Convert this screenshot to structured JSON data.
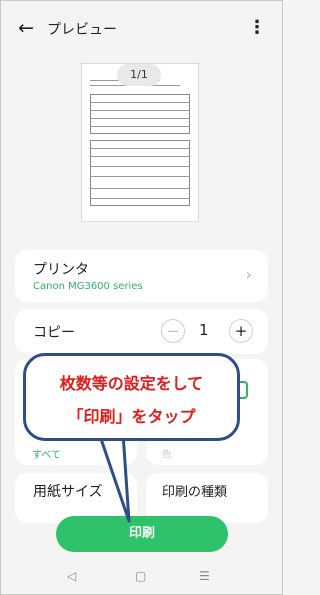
{
  "header": {
    "title": "プレビュー",
    "back_icon": "←",
    "more_icon": "⋮"
  },
  "preview": {
    "page_indicator": "1/1"
  },
  "printer": {
    "label": "プリンタ",
    "name": "Canon MG3600 series",
    "chevron": "›"
  },
  "copies": {
    "label": "コピー",
    "count": "1",
    "minus": "−",
    "plus": "+"
  },
  "range": {
    "value": "すべて"
  },
  "color": {
    "value": "色"
  },
  "paper_size": {
    "label": "用紙サイズ"
  },
  "print_type": {
    "label": "印刷の種類"
  },
  "print_button": {
    "label": "印刷"
  },
  "callout": {
    "line1": "枚数等の設定をして",
    "line2": "「印刷」をタップ"
  },
  "nav": {
    "back": "◁",
    "home": "▢",
    "recent": "☰"
  },
  "colors": {
    "accent": "#2ec36a",
    "accent_text": "#2db561",
    "callout_border": "#2f4d88",
    "callout_text": "#e21b1b"
  }
}
